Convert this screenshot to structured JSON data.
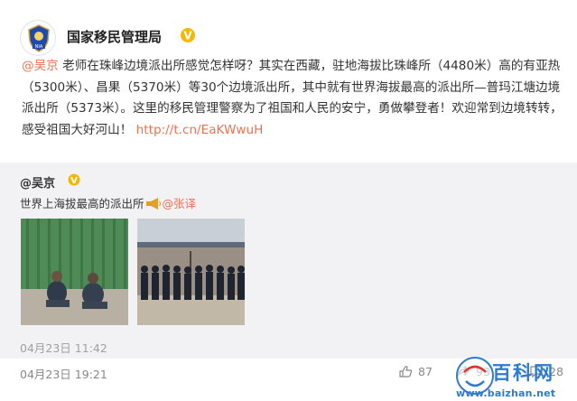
{
  "post": {
    "author": "国家移民管理局",
    "avatar_logo_text": "NIA",
    "text_mention": "@吴京",
    "text_body": " 老师在珠峰边境派出所感觉怎样呀？其实在西藏，驻地海拔比珠峰所（4480米）高的有亚热（5300米）、昌果（5370米）等30个边境派出所，其中就有世界海拔最高的派出所—普玛江塘边境派出所（5373米）。这里的移民管理警察为了祖国和人民的安宁，勇做攀登者！欢迎常到边境转转，感受祖国大好河山！ ",
    "text_link": "http://t.cn/EaKWwuH",
    "time": "04月23日 19:21"
  },
  "repost": {
    "author": "@吴京",
    "text_before": "世界上海拔最高的派出所",
    "text_mention": "@张译",
    "time": "04月23日 11:42"
  },
  "actions": {
    "likes": "87",
    "shares": "93",
    "comments": "28"
  },
  "watermark": {
    "text": "百科网",
    "url": "www.baizhan.net"
  },
  "colors": {
    "mention": "#eb7350",
    "verified": "#f5b700",
    "repost_bg": "#f2f2f5",
    "watermark": "#2c7bd0"
  },
  "icons": [
    "police-badge-icon",
    "verified-badge-icon",
    "horn-icon",
    "like-icon",
    "share-icon",
    "comment-icon"
  ]
}
